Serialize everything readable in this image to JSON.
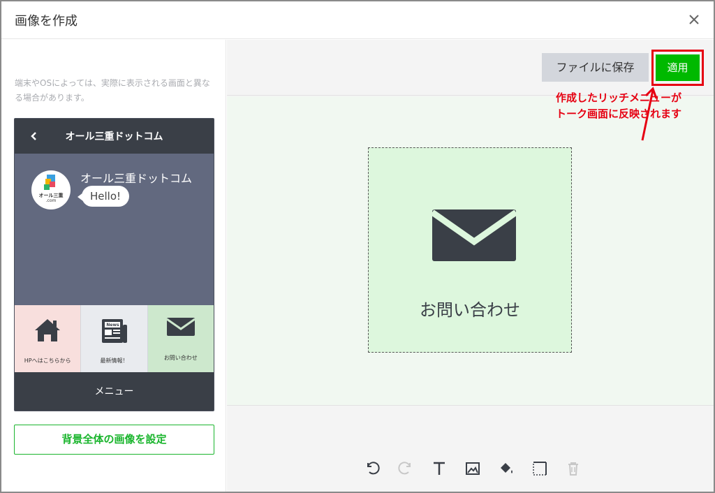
{
  "dialog": {
    "title": "画像を作成"
  },
  "left": {
    "note": "端末やOSによっては、実際に表示される画面と異なる場合があります。",
    "phone": {
      "header_title": "オール三重ドットコム",
      "account_name": "オール三重ドットコム",
      "bubble": "Hello!",
      "avatar_text": "オール三重",
      "avatar_sub": ".com",
      "rich_menu": [
        {
          "label": "HPへはこちらから",
          "icon": "home-icon",
          "bg": "#f8dfdd"
        },
        {
          "label": "最新情報！",
          "icon": "newspaper-icon",
          "bg": "#e9ebef"
        },
        {
          "label": "お問い合わせ",
          "icon": "envelope-icon",
          "bg": "#cde8cd"
        }
      ],
      "newspaper_icon_text": "News",
      "menu_bar": "メニュー"
    },
    "bg_button": "背景全体の画像を設定"
  },
  "right": {
    "save_button": "ファイルに保存",
    "apply_button": "適用",
    "tile_label": "お問い合わせ",
    "annotation_line1": "作成したリッチメニューが",
    "annotation_line2": "トーク画面に反映されます"
  },
  "colors": {
    "accent": "#00b900",
    "annotation": "#e60012",
    "dark": "#3a3f47"
  },
  "tools": [
    "undo-icon",
    "redo-icon",
    "text-icon",
    "image-icon",
    "fill-icon",
    "border-icon",
    "trash-icon"
  ]
}
